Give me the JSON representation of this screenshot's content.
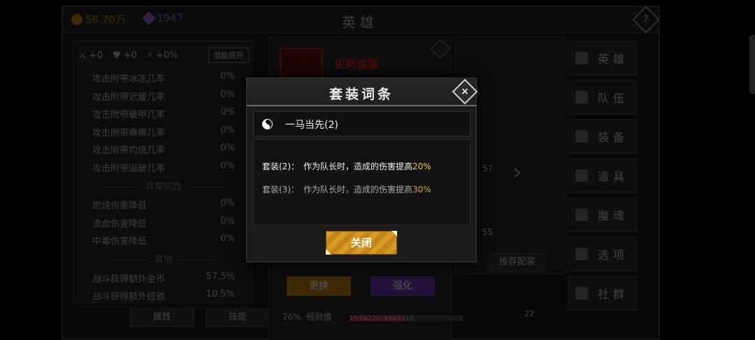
{
  "resources": {
    "gold": "56.70万",
    "gems": "1947"
  },
  "page_title": "英雄",
  "help_label": "?",
  "stats_panel": {
    "icon_values": [
      "+0",
      "+0",
      "+0%"
    ],
    "button_label": "潜能提升",
    "rows_top": [
      {
        "label": "攻击附带冰冻几率",
        "value": "0%"
      },
      {
        "label": "攻击附带迟缓几率",
        "value": "0%"
      },
      {
        "label": "攻击附带破甲几率",
        "value": "0%"
      },
      {
        "label": "攻击附带麻痹几率",
        "value": "0%"
      },
      {
        "label": "攻击附带灼烧几率",
        "value": "0%"
      },
      {
        "label": "攻击附带溢破几率",
        "value": "0%"
      }
    ],
    "section_resist": "异常抗性",
    "rows_resist": [
      {
        "label": "燃烧伤害降低",
        "value": "0%"
      },
      {
        "label": "流血伤害降低",
        "value": "0%"
      },
      {
        "label": "中毒伤害降低",
        "value": "0%"
      }
    ],
    "section_other": "其他",
    "rows_other": [
      {
        "label": "战斗获得额外金币",
        "value": "57.5%"
      },
      {
        "label": "战斗获得额外经验",
        "value": "10.5%"
      }
    ],
    "tabs": [
      "属性",
      "技能"
    ]
  },
  "item_panel": {
    "item_name": "尖刺金盔",
    "replace_label": "更换",
    "enhance_label": "强化",
    "level_text": "76%",
    "exp_label": "经验值",
    "exp_text": "1576220/3343310",
    "exp_fraction": 0.47,
    "recommend_label": "推荐配装",
    "num_a": "57",
    "num_b": "55",
    "num_c": "22"
  },
  "nav": [
    "英雄",
    "队伍",
    "装备",
    "道具",
    "魔魂",
    "选项",
    "社群"
  ],
  "modal": {
    "title": "套装词条",
    "close_label": "×",
    "set_name": "一马当先(2)",
    "effects": [
      {
        "label": "套装(2)：",
        "text": "作为队长时，造成的伤害提高",
        "pct": "20%",
        "active": true
      },
      {
        "label": "套装(3)：",
        "text": "作为队长时，造成的伤害提高",
        "pct": "30%",
        "active": false
      }
    ],
    "button_label": "关闭"
  },
  "colors": {
    "accent_gold": "#d89a22",
    "highlight_yellow": "#f0d030",
    "enhance_purple": "#6a3ab0",
    "item_red": "#e02020"
  }
}
